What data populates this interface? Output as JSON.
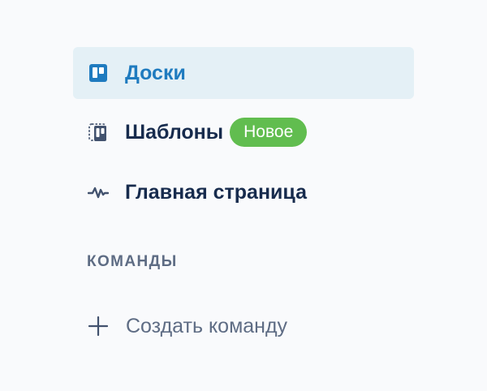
{
  "nav": {
    "items": [
      {
        "label": "Доски",
        "icon": "board-icon",
        "active": true
      },
      {
        "label": "Шаблоны",
        "icon": "template-icon",
        "badge": "Новое"
      },
      {
        "label": "Главная страница",
        "icon": "activity-icon"
      }
    ]
  },
  "teams": {
    "header": "КОМАНДЫ",
    "create_label": "Создать команду",
    "create_icon": "plus-icon"
  },
  "colors": {
    "background": "#f9fafc",
    "active_bg": "#e4f0f6",
    "active_text": "#1f7bbf",
    "text": "#172b4d",
    "muted": "#5e6c84",
    "badge": "#61bd4f"
  }
}
